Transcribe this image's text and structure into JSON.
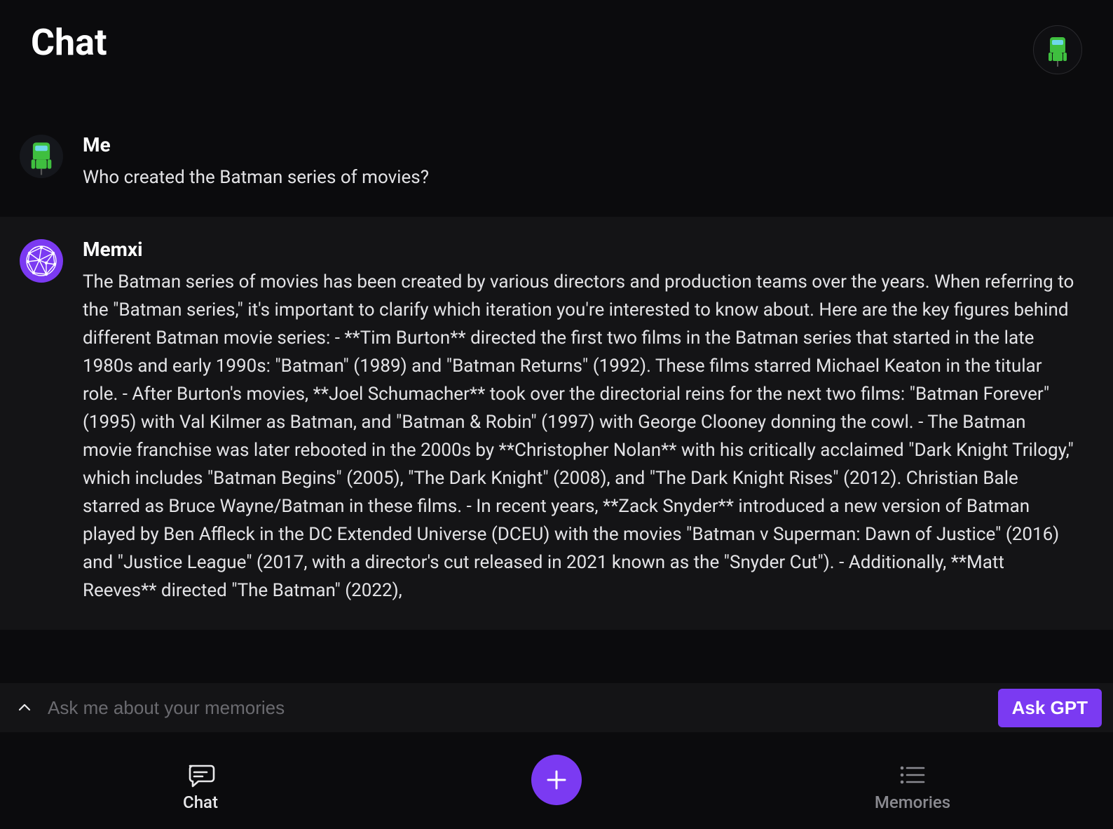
{
  "header": {
    "title": "Chat"
  },
  "messages": {
    "user": {
      "name": "Me",
      "text": "Who created the Batman series of movies?"
    },
    "assistant": {
      "name": "Memxi",
      "text": "The Batman series of movies has been created by various directors and production teams over the years. When referring to the \"Batman series,\" it's important to clarify which iteration you're interested to know about. Here are the key figures behind different Batman movie series: - **Tim Burton** directed the first two films in the Batman series that started in the late 1980s and early 1990s: \"Batman\" (1989) and \"Batman Returns\" (1992). These films starred Michael Keaton in the titular role. - After Burton's movies, **Joel Schumacher** took over the directorial reins for the next two films: \"Batman Forever\" (1995) with Val Kilmer as Batman, and \"Batman & Robin\" (1997) with George Clooney donning the cowl. - The Batman movie franchise was later rebooted in the 2000s by **Christopher Nolan** with his critically acclaimed \"Dark Knight Trilogy,\" which includes \"Batman Begins\" (2005), \"The Dark Knight\" (2008), and \"The Dark Knight Rises\" (2012). Christian Bale starred as Bruce Wayne/Batman in these films. - In recent years, **Zack Snyder** introduced a new version of Batman played by Ben Affleck in the DC Extended Universe (DCEU) with the movies \"Batman v Superman: Dawn of Justice\" (2016) and \"Justice League\" (2017, with a director's cut released in 2021 known as the \"Snyder Cut\"). - Additionally, **Matt Reeves** directed \"The Batman\" (2022),"
    }
  },
  "input": {
    "placeholder": "Ask me about your memories",
    "ask_label": "Ask GPT"
  },
  "nav": {
    "chat": "Chat",
    "memories": "Memories"
  },
  "colors": {
    "accent": "#7b3af2"
  }
}
